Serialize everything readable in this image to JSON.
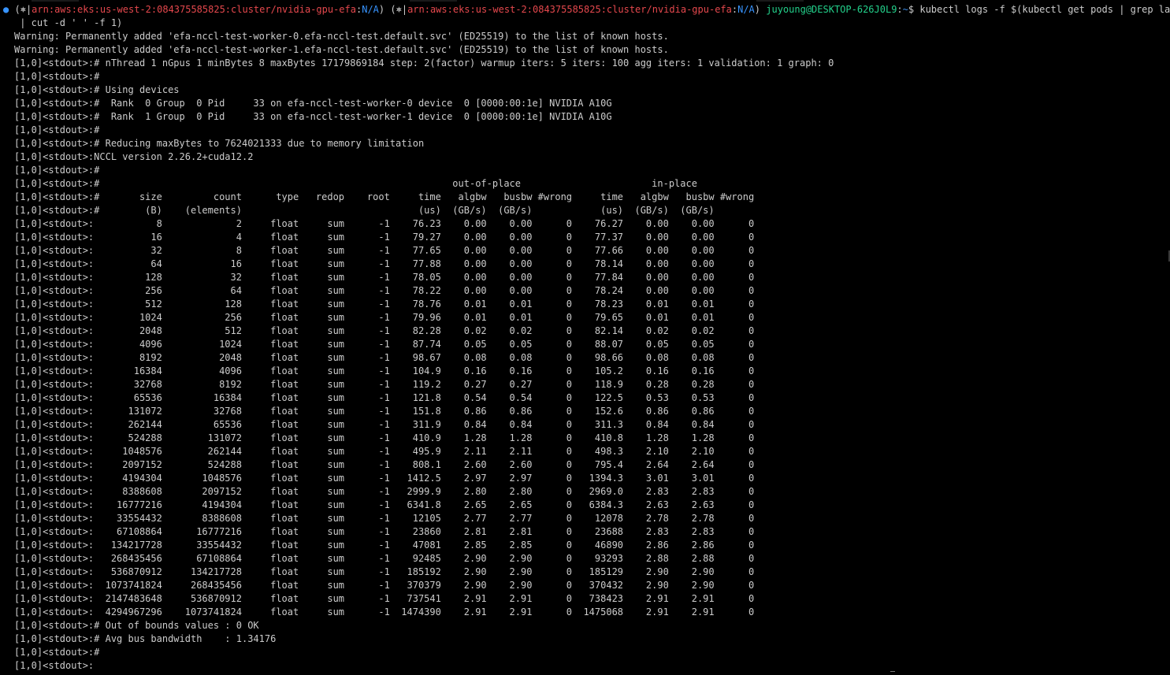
{
  "prompt": {
    "status_dot": "●",
    "k8s_symbol": "⎈",
    "context": "arn:aws:eks:us-west-2:084375585825:cluster/nvidia-gpu-efa",
    "namespace": "N/A",
    "user_host": "juyoung@DESKTOP-626J0L9",
    "path": "~",
    "dollar": "$",
    "command": "kubectl logs -f $(kubectl get pods | grep launcher",
    "continuation": " | cut -d ' ' -f 1)"
  },
  "output_lines": [
    "Warning: Permanently added 'efa-nccl-test-worker-0.efa-nccl-test.default.svc' (ED25519) to the list of known hosts.",
    "Warning: Permanently added 'efa-nccl-test-worker-1.efa-nccl-test.default.svc' (ED25519) to the list of known hosts.",
    "[1,0]<stdout>:# nThread 1 nGpus 1 minBytes 8 maxBytes 17179869184 step: 2(factor) warmup iters: 5 iters: 100 agg iters: 1 validation: 1 graph: 0",
    "[1,0]<stdout>:#",
    "[1,0]<stdout>:# Using devices",
    "[1,0]<stdout>:#  Rank  0 Group  0 Pid     33 on efa-nccl-test-worker-0 device  0 [0000:00:1e] NVIDIA A10G",
    "[1,0]<stdout>:#  Rank  1 Group  0 Pid     33 on efa-nccl-test-worker-1 device  0 [0000:00:1e] NVIDIA A10G",
    "[1,0]<stdout>:#",
    "[1,0]<stdout>:# Reducing maxBytes to 7624021333 due to memory limitation",
    "[1,0]<stdout>:NCCL version 2.26.2+cuda12.2",
    "[1,0]<stdout>:#",
    "[1,0]<stdout>:#                                                              out-of-place                       in-place",
    "[1,0]<stdout>:#       size         count      type   redop    root     time   algbw   busbw #wrong     time   algbw   busbw #wrong",
    "[1,0]<stdout>:#        (B)    (elements)                               (us)  (GB/s)  (GB/s)            (us)  (GB/s)  (GB/s)",
    "[1,0]<stdout>:           8             2     float     sum      -1    76.23    0.00    0.00      0    76.27    0.00    0.00      0",
    "[1,0]<stdout>:          16             4     float     sum      -1    79.27    0.00    0.00      0    77.37    0.00    0.00      0",
    "[1,0]<stdout>:          32             8     float     sum      -1    77.65    0.00    0.00      0    77.66    0.00    0.00      0",
    "[1,0]<stdout>:          64            16     float     sum      -1    77.88    0.00    0.00      0    78.14    0.00    0.00      0",
    "[1,0]<stdout>:         128            32     float     sum      -1    78.05    0.00    0.00      0    77.84    0.00    0.00      0",
    "[1,0]<stdout>:         256            64     float     sum      -1    78.22    0.00    0.00      0    78.24    0.00    0.00      0",
    "[1,0]<stdout>:         512           128     float     sum      -1    78.76    0.01    0.01      0    78.23    0.01    0.01      0",
    "[1,0]<stdout>:        1024           256     float     sum      -1    79.96    0.01    0.01      0    79.65    0.01    0.01      0",
    "[1,0]<stdout>:        2048           512     float     sum      -1    82.28    0.02    0.02      0    82.14    0.02    0.02      0",
    "[1,0]<stdout>:        4096          1024     float     sum      -1    87.74    0.05    0.05      0    88.07    0.05    0.05      0",
    "[1,0]<stdout>:        8192          2048     float     sum      -1    98.67    0.08    0.08      0    98.66    0.08    0.08      0",
    "[1,0]<stdout>:       16384          4096     float     sum      -1    104.9    0.16    0.16      0    105.2    0.16    0.16      0",
    "[1,0]<stdout>:       32768          8192     float     sum      -1    119.2    0.27    0.27      0    118.9    0.28    0.28      0",
    "[1,0]<stdout>:       65536         16384     float     sum      -1    121.8    0.54    0.54      0    122.5    0.53    0.53      0",
    "[1,0]<stdout>:      131072         32768     float     sum      -1    151.8    0.86    0.86      0    152.6    0.86    0.86      0",
    "[1,0]<stdout>:      262144         65536     float     sum      -1    311.9    0.84    0.84      0    311.3    0.84    0.84      0",
    "[1,0]<stdout>:      524288        131072     float     sum      -1    410.9    1.28    1.28      0    410.8    1.28    1.28      0",
    "[1,0]<stdout>:     1048576        262144     float     sum      -1    495.9    2.11    2.11      0    498.3    2.10    2.10      0",
    "[1,0]<stdout>:     2097152        524288     float     sum      -1    808.1    2.60    2.60      0    795.4    2.64    2.64      0",
    "[1,0]<stdout>:     4194304       1048576     float     sum      -1   1412.5    2.97    2.97      0   1394.3    3.01    3.01      0",
    "[1,0]<stdout>:     8388608       2097152     float     sum      -1   2999.9    2.80    2.80      0   2969.0    2.83    2.83      0",
    "[1,0]<stdout>:    16777216       4194304     float     sum      -1   6341.8    2.65    2.65      0   6384.3    2.63    2.63      0",
    "[1,0]<stdout>:    33554432       8388608     float     sum      -1    12105    2.77    2.77      0    12078    2.78    2.78      0",
    "[1,0]<stdout>:    67108864      16777216     float     sum      -1    23860    2.81    2.81      0    23688    2.83    2.83      0",
    "[1,0]<stdout>:   134217728      33554432     float     sum      -1    47081    2.85    2.85      0    46890    2.86    2.86      0",
    "[1,0]<stdout>:   268435456      67108864     float     sum      -1    92485    2.90    2.90      0    93293    2.88    2.88      0",
    "[1,0]<stdout>:   536870912     134217728     float     sum      -1   185192    2.90    2.90      0   185129    2.90    2.90      0",
    "[1,0]<stdout>:  1073741824     268435456     float     sum      -1   370379    2.90    2.90      0   370432    2.90    2.90      0",
    "[1,0]<stdout>:  2147483648     536870912     float     sum      -1   737541    2.91    2.91      0   738423    2.91    2.91      0",
    "[1,0]<stdout>:  4294967296    1073741824     float     sum      -1  1474390    2.91    2.91      0  1475068    2.91    2.91      0",
    "[1,0]<stdout>:# Out of bounds values : 0 OK",
    "[1,0]<stdout>:# Avg bus bandwidth    : 1.34176",
    "[1,0]<stdout>:#",
    "[1,0]<stdout>:"
  ]
}
